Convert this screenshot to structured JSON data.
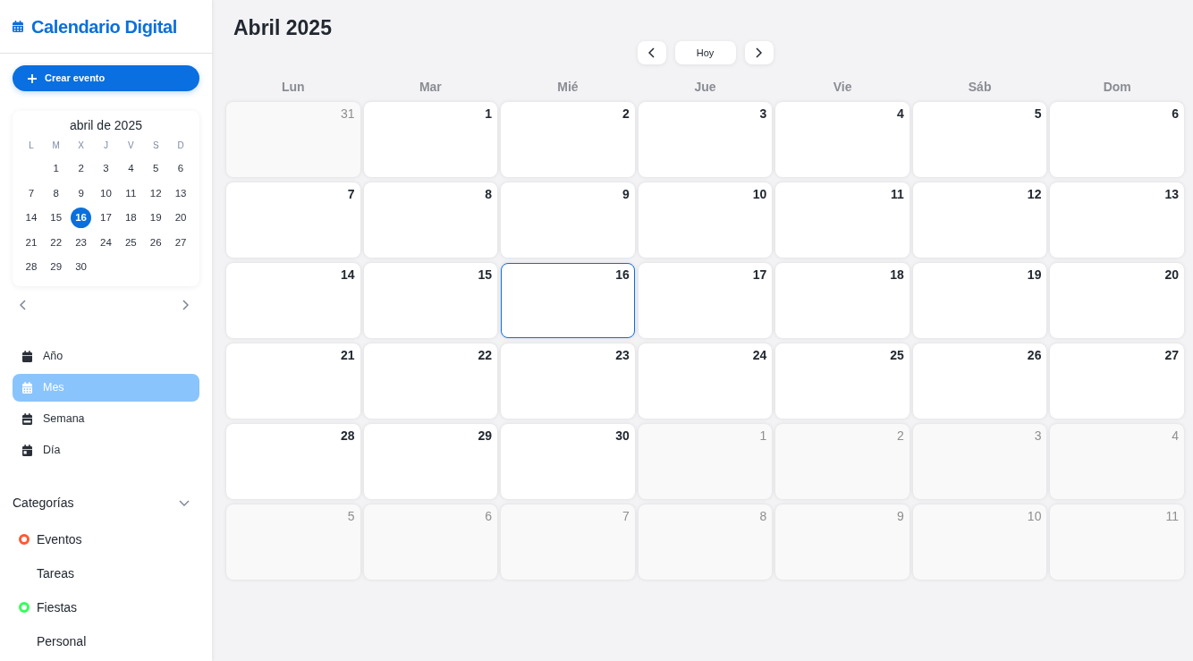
{
  "sidebar": {
    "app_title": "Calendario Digital",
    "create_button": "Crear evento",
    "mini_calendar": {
      "title": "abril de 2025",
      "weekdays": [
        "L",
        "M",
        "X",
        "J",
        "V",
        "S",
        "D"
      ],
      "weeks": [
        [
          {
            "label": "1",
            "selected": false
          },
          {
            "label": "2",
            "selected": false
          },
          {
            "label": "3",
            "selected": false
          },
          {
            "label": "4",
            "selected": false
          },
          {
            "label": "5",
            "selected": false
          },
          {
            "label": "6",
            "selected": false
          }
        ],
        [
          {
            "label": "7",
            "selected": false
          },
          {
            "label": "8",
            "selected": false
          },
          {
            "label": "9",
            "selected": false
          },
          {
            "label": "10",
            "selected": false
          },
          {
            "label": "11",
            "selected": false
          },
          {
            "label": "12",
            "selected": false
          },
          {
            "label": "13",
            "selected": false
          }
        ],
        [
          {
            "label": "14",
            "selected": false
          },
          {
            "label": "15",
            "selected": false
          },
          {
            "label": "16",
            "selected": true
          },
          {
            "label": "17",
            "selected": false
          },
          {
            "label": "18",
            "selected": false
          },
          {
            "label": "19",
            "selected": false
          },
          {
            "label": "20",
            "selected": false
          }
        ],
        [
          {
            "label": "21",
            "selected": false
          },
          {
            "label": "22",
            "selected": false
          },
          {
            "label": "23",
            "selected": false
          },
          {
            "label": "24",
            "selected": false
          },
          {
            "label": "25",
            "selected": false
          },
          {
            "label": "26",
            "selected": false
          },
          {
            "label": "27",
            "selected": false
          }
        ],
        [
          {
            "label": "28",
            "selected": false
          },
          {
            "label": "29",
            "selected": false
          },
          {
            "label": "30",
            "selected": false
          }
        ]
      ]
    },
    "views": [
      {
        "kind": "year",
        "label": "Año",
        "selected": false
      },
      {
        "kind": "month",
        "label": "Mes",
        "selected": true
      },
      {
        "kind": "week",
        "label": "Semana",
        "selected": false
      },
      {
        "kind": "day",
        "label": "Día",
        "selected": false
      }
    ],
    "categories": {
      "title": "Categorías",
      "expanded": true,
      "items": [
        {
          "label": "Eventos",
          "color": "#ff5733"
        },
        {
          "label": "Tareas"
        },
        {
          "label": "Fiestas",
          "color": "#33ff57"
        },
        {
          "label": "Personal"
        }
      ]
    }
  },
  "main": {
    "title": "Abril 2025",
    "today_button": "Hoy",
    "weekdays": [
      "Lun",
      "Mar",
      "Mié",
      "Jue",
      "Vie",
      "Sáb",
      "Dom"
    ],
    "cells": [
      {
        "day": "31",
        "other_month": true,
        "selected": false
      },
      {
        "day": "1",
        "other_month": false,
        "selected": false
      },
      {
        "day": "2",
        "other_month": false,
        "selected": false
      },
      {
        "day": "3",
        "other_month": false,
        "selected": false
      },
      {
        "day": "4",
        "other_month": false,
        "selected": false
      },
      {
        "day": "5",
        "other_month": false,
        "selected": false
      },
      {
        "day": "6",
        "other_month": false,
        "selected": false
      },
      {
        "day": "7",
        "other_month": false,
        "selected": false
      },
      {
        "day": "8",
        "other_month": false,
        "selected": false
      },
      {
        "day": "9",
        "other_month": false,
        "selected": false
      },
      {
        "day": "10",
        "other_month": false,
        "selected": false
      },
      {
        "day": "11",
        "other_month": false,
        "selected": false
      },
      {
        "day": "12",
        "other_month": false,
        "selected": false
      },
      {
        "day": "13",
        "other_month": false,
        "selected": false
      },
      {
        "day": "14",
        "other_month": false,
        "selected": false
      },
      {
        "day": "15",
        "other_month": false,
        "selected": false
      },
      {
        "day": "16",
        "other_month": false,
        "selected": true
      },
      {
        "day": "17",
        "other_month": false,
        "selected": false
      },
      {
        "day": "18",
        "other_month": false,
        "selected": false
      },
      {
        "day": "19",
        "other_month": false,
        "selected": false
      },
      {
        "day": "20",
        "other_month": false,
        "selected": false
      },
      {
        "day": "21",
        "other_month": false,
        "selected": false
      },
      {
        "day": "22",
        "other_month": false,
        "selected": false
      },
      {
        "day": "23",
        "other_month": false,
        "selected": false
      },
      {
        "day": "24",
        "other_month": false,
        "selected": false
      },
      {
        "day": "25",
        "other_month": false,
        "selected": false
      },
      {
        "day": "26",
        "other_month": false,
        "selected": false
      },
      {
        "day": "27",
        "other_month": false,
        "selected": false
      },
      {
        "day": "28",
        "other_month": false,
        "selected": false
      },
      {
        "day": "29",
        "other_month": false,
        "selected": false
      },
      {
        "day": "30",
        "other_month": false,
        "selected": false
      },
      {
        "day": "1",
        "other_month": true,
        "selected": false
      },
      {
        "day": "2",
        "other_month": true,
        "selected": false
      },
      {
        "day": "3",
        "other_month": true,
        "selected": false
      },
      {
        "day": "4",
        "other_month": true,
        "selected": false
      },
      {
        "day": "5",
        "other_month": true,
        "selected": false
      },
      {
        "day": "6",
        "other_month": true,
        "selected": false
      },
      {
        "day": "7",
        "other_month": true,
        "selected": false
      },
      {
        "day": "8",
        "other_month": true,
        "selected": false
      },
      {
        "day": "9",
        "other_month": true,
        "selected": false
      },
      {
        "day": "10",
        "other_month": true,
        "selected": false
      },
      {
        "day": "11",
        "other_month": true,
        "selected": false
      }
    ]
  }
}
